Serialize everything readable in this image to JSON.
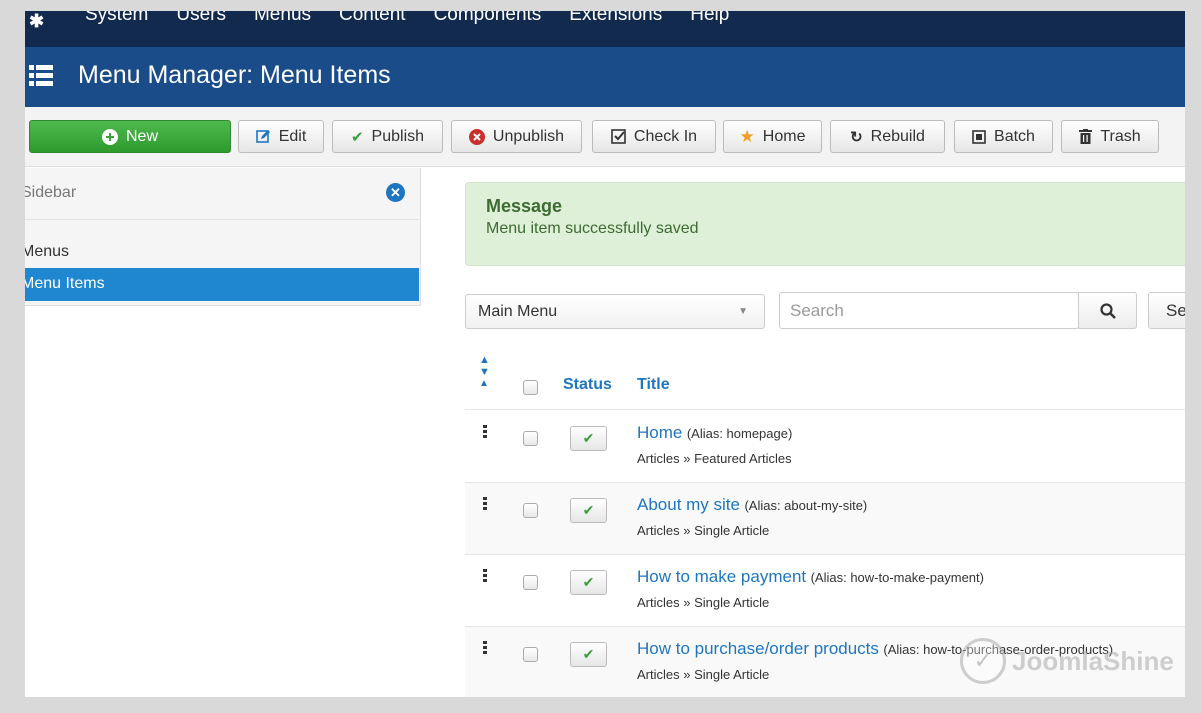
{
  "topnav": {
    "items": [
      "System",
      "Users",
      "Menus",
      "Content",
      "Components",
      "Extensions",
      "Help"
    ]
  },
  "header": {
    "title": "Menu Manager: Menu Items",
    "icon": "list-icon"
  },
  "toolbar": {
    "new": "New",
    "edit": "Edit",
    "publish": "Publish",
    "unpublish": "Unpublish",
    "checkin": "Check In",
    "home": "Home",
    "rebuild": "Rebuild",
    "batch": "Batch",
    "trash": "Trash"
  },
  "sidebar": {
    "title": "Sidebar",
    "items": [
      {
        "label": "Menus",
        "active": false
      },
      {
        "label": "Menu Items",
        "active": true
      }
    ]
  },
  "message": {
    "heading": "Message",
    "text": "Menu item successfully saved"
  },
  "filters": {
    "menu_select": "Main Menu",
    "search_placeholder": "Search",
    "search_tools_label": "Se"
  },
  "table": {
    "col_status": "Status",
    "col_title": "Title",
    "rows": [
      {
        "title": "Home",
        "alias": "(Alias: homepage)",
        "type": "Articles » Featured Articles"
      },
      {
        "title": "About my site",
        "alias": "(Alias: about-my-site)",
        "type": "Articles » Single Article"
      },
      {
        "title": "How to make payment",
        "alias": "(Alias: how-to-make-payment)",
        "type": "Articles » Single Article"
      },
      {
        "title": "How to purchase/order products",
        "alias": "(Alias: how-to-purchase-order-products)",
        "type": "Articles » Single Article"
      }
    ]
  },
  "watermark": "JoomlaShine",
  "colors": {
    "nav_dark": "#132a4f",
    "header_blue": "#1a4c8a",
    "new_green": "#3aa63a",
    "link_blue": "#1e76c0",
    "active_blue": "#1e87d0",
    "message_bg": "#dff0d8"
  }
}
